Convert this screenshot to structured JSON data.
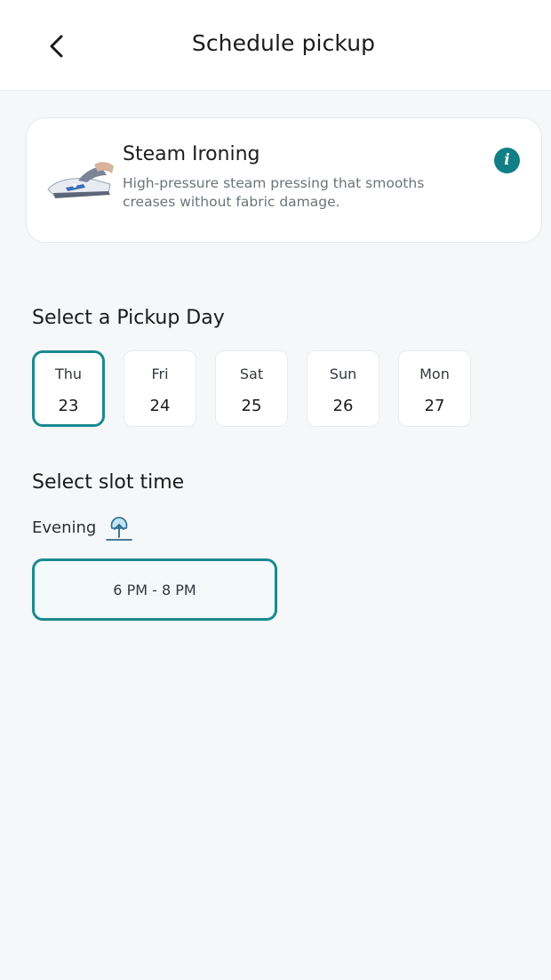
{
  "header": {
    "title": "Schedule pickup",
    "back_icon": "chevron-left-icon"
  },
  "service": {
    "name": "Steam Ironing",
    "description": "High-pressure steam pressing that smooths creases without fabric damage.",
    "image_icon": "steam-iron-image",
    "info_icon": "info-icon"
  },
  "pickup_day": {
    "title": "Select a Pickup Day",
    "selected_index": 0,
    "days": [
      {
        "name": "Thu",
        "date": "23"
      },
      {
        "name": "Fri",
        "date": "24"
      },
      {
        "name": "Sat",
        "date": "25"
      },
      {
        "name": "Sun",
        "date": "26"
      },
      {
        "name": "Mon",
        "date": "27"
      }
    ]
  },
  "slot_time": {
    "title": "Select slot time",
    "period": "Evening",
    "period_icon": "sunset-icon",
    "slots": [
      {
        "label": "6 PM - 8 PM",
        "selected": true
      }
    ]
  },
  "colors": {
    "accent": "#1a8a8f",
    "background": "#f6f7f9",
    "card": "#ffffff",
    "info": "#127f86"
  }
}
